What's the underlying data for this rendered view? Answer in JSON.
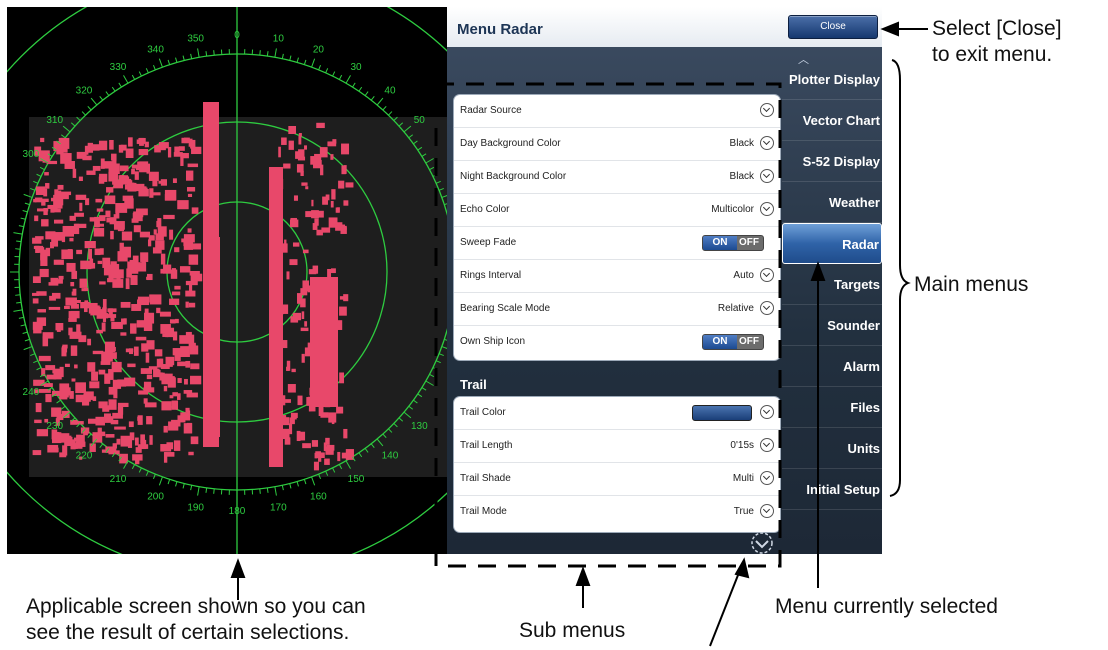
{
  "menu": {
    "title": "Menu Radar",
    "close_label": "Close",
    "main_items": [
      "Plotter Display",
      "Vector Chart",
      "S-52 Display",
      "Weather",
      "Radar",
      "Targets",
      "Sounder",
      "Alarm",
      "Files",
      "Units",
      "Initial Setup"
    ],
    "selected_item": "Radar",
    "radar_rows": [
      {
        "label": "Radar Source",
        "value": ""
      },
      {
        "label": "Day Background Color",
        "value": "Black"
      },
      {
        "label": "Night Background Color",
        "value": "Black"
      },
      {
        "label": "Echo Color",
        "value": "Multicolor"
      },
      {
        "label": "Sweep Fade",
        "value": ""
      },
      {
        "label": "Rings Interval",
        "value": "Auto"
      },
      {
        "label": "Bearing Scale Mode",
        "value": "Relative"
      },
      {
        "label": "Own Ship Icon",
        "value": ""
      }
    ],
    "toggle_on": "ON",
    "toggle_off": "OFF",
    "trail_section_title": "Trail",
    "trail_rows": [
      {
        "label": "Trail Color",
        "value": ""
      },
      {
        "label": "Trail Length",
        "value": "0'15s"
      },
      {
        "label": "Trail Shade",
        "value": "Multi"
      },
      {
        "label": "Trail Mode",
        "value": "True"
      }
    ]
  },
  "radar": {
    "bearing_labels": [
      "350",
      "0",
      "10",
      "20",
      "30",
      "40",
      "50",
      "340",
      "330",
      "320",
      "310",
      "300",
      "240",
      "230",
      "220",
      "210",
      "200",
      "190",
      "180",
      "170",
      "160",
      "150",
      "140",
      "130"
    ]
  },
  "annotations": {
    "close": "Select [Close]\nto exit menu.",
    "main_menus": "Main menus",
    "current": "Menu currently selected",
    "sub_menus": "Sub menus",
    "applicable": "Applicable screen shown so you can\nsee the result of certain selections."
  },
  "colors": {
    "accent": "#1c4a91",
    "echo": "#e8486a",
    "ring": "#2ecc40"
  }
}
